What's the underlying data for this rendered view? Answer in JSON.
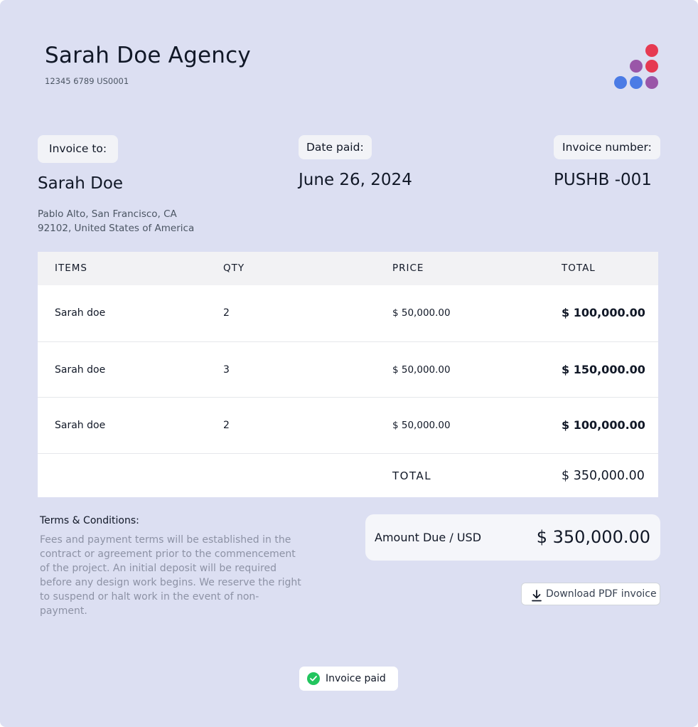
{
  "agency": {
    "name": "Sarah Doe Agency",
    "id": "12345 6789 US0001"
  },
  "logo": {
    "icon": "dots-logo-icon",
    "colors": {
      "red": "#e63a52",
      "purple": "#9a56a8",
      "blue": "#4b7be5"
    }
  },
  "invoice_to": {
    "label": "Invoice to:",
    "name": "Sarah Doe",
    "address_line1": "Pablo Alto, San Francisco, CA",
    "address_line2": "92102, United States of America"
  },
  "date_paid": {
    "label": "Date paid:",
    "value": "June 26, 2024"
  },
  "invoice_number": {
    "label": "Invoice number:",
    "value": "PUSHB -001"
  },
  "table": {
    "headers": [
      "ITEMS",
      "QTY",
      "PRICE",
      "TOTAL"
    ],
    "rows": [
      {
        "item": "Sarah doe",
        "qty": "2",
        "price": "$ 50,000.00",
        "total": "$ 100,000.00"
      },
      {
        "item": "Sarah doe",
        "qty": "3",
        "price": "$ 50,000.00",
        "total": "$ 150,000.00"
      },
      {
        "item": "Sarah doe",
        "qty": "2",
        "price": "$ 50,000.00",
        "total": "$ 100,000.00"
      }
    ],
    "total_label": "TOTAL",
    "total_value": "$ 350,000.00"
  },
  "terms": {
    "title": "Terms & Conditions:",
    "text": "Fees and payment terms will be established in the contract or agreement prior to the commencement of the project. An initial deposit will be required before any design work begins. We reserve the right to suspend or halt work in the event of non-payment."
  },
  "amount_due": {
    "label": "Amount Due / USD",
    "value": "$ 350,000.00"
  },
  "download": {
    "label": "Download PDF invoice",
    "icon": "download-icon"
  },
  "status": {
    "label": "Invoice paid",
    "icon": "check-circle-icon",
    "color": "#22c55e"
  }
}
